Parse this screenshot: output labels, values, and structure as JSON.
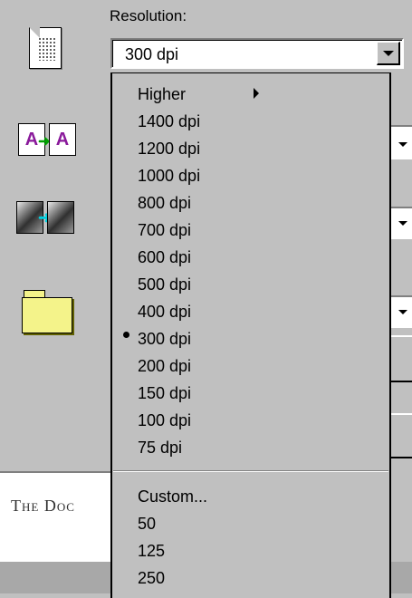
{
  "resolution": {
    "label": "Resolution:",
    "selected": "300 dpi"
  },
  "menu": {
    "items": [
      {
        "label": "Higher",
        "submenu": true
      },
      {
        "label": "1400 dpi"
      },
      {
        "label": "1200 dpi"
      },
      {
        "label": "1000 dpi"
      },
      {
        "label": "800 dpi"
      },
      {
        "label": "700 dpi"
      },
      {
        "label": "600 dpi"
      },
      {
        "label": "500 dpi"
      },
      {
        "label": "400 dpi"
      },
      {
        "label": "300 dpi",
        "checked": true
      },
      {
        "label": "200 dpi"
      },
      {
        "label": "150 dpi"
      },
      {
        "label": "100 dpi"
      },
      {
        "label": "75 dpi"
      }
    ],
    "custom_items": [
      {
        "label": "Custom..."
      },
      {
        "label": "50"
      },
      {
        "label": "125"
      },
      {
        "label": "250"
      }
    ]
  },
  "icons": {
    "translate_letters": [
      "A",
      "A"
    ]
  },
  "bottom": {
    "partial_text": "The Doc"
  }
}
